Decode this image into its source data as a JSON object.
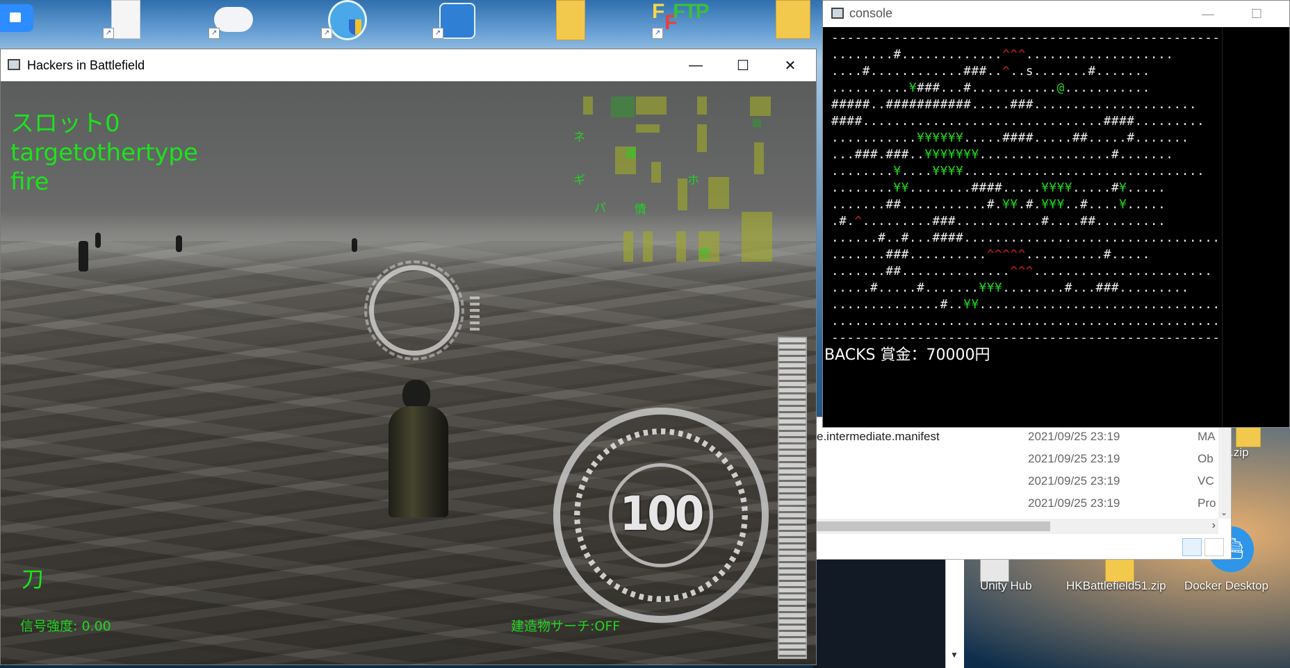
{
  "desktop": {
    "icons_bottom": [
      {
        "label": "Unity Hub"
      },
      {
        "label": "HKBattlefield51.zip"
      },
      {
        "label": "Docker Desktop"
      }
    ],
    "partial_zip_label": ".zip"
  },
  "game_window": {
    "title": "Hackers in Battlefield",
    "minimize": "—",
    "maximize": "☐",
    "close": "✕",
    "hud": {
      "slot": "スロット0",
      "mode": "targetothertype",
      "action": "fire",
      "weapon": "刀",
      "signal": "信号強度:  0.00",
      "building_search": "建造物サーチ:OFF",
      "dial_value": "100"
    },
    "minimap_labels": [
      "ネ",
      "運",
      "ギ",
      "ホ",
      "パ",
      "情",
      "売"
    ]
  },
  "console_window": {
    "title": "console",
    "minimize": "—",
    "maximize": "☐",
    "status": "BACKS 賞金：70000円"
  },
  "explorer": {
    "rows": [
      {
        "name": "e.intermediate.manifest",
        "date": "2021/09/25 23:19",
        "type": "MA"
      },
      {
        "name": "",
        "date": "2021/09/25 23:19",
        "type": "Ob"
      },
      {
        "name": "",
        "date": "2021/09/25 23:19",
        "type": "VC"
      },
      {
        "name": "",
        "date": "2021/09/25 23:19",
        "type": "Pro"
      }
    ]
  }
}
